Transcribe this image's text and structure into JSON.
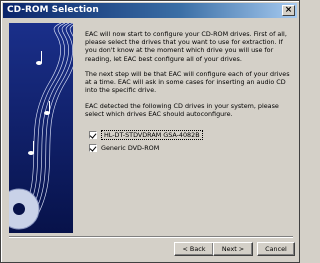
{
  "window": {
    "title": "CD-ROM Selection",
    "close_glyph": "×"
  },
  "paragraphs": [
    "EAC will now start to configure your CD-ROM drives. First of all, please select the drives that you want to use for extraction. If you don't know at the moment which drive you will use for reading, let EAC best configure all of your drives.",
    "The next step will be that EAC will configure each of your drives at a time. EAC will ask in some cases for inserting an audio CD into the specific drive.",
    "EAC detected the following CD drives in your system, please select which drives EAC should autoconfigure."
  ],
  "drives": [
    {
      "label": "HL-DT-STDVDRAM GSA-4082B",
      "checked": true
    },
    {
      "label": "Generic DVD-ROM",
      "checked": true
    }
  ],
  "buttons": {
    "back": "< Back",
    "next": "Next >",
    "cancel": "Cancel"
  },
  "side_panel_icon": "music-staff-cd-icon",
  "colors": {
    "titlebar": "#0a246a",
    "side_panel": "#0c1c6a",
    "face": "#d4d0c8"
  }
}
